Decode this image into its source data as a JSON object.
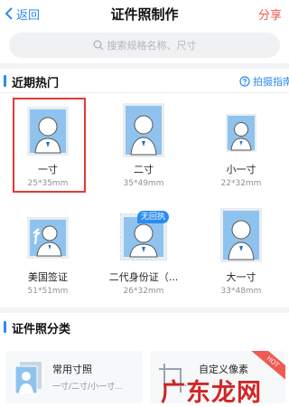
{
  "header": {
    "back_label": "返回",
    "title": "证件照制作",
    "share_label": "分享"
  },
  "search": {
    "placeholder": "搜索规格名称、尺寸"
  },
  "hot": {
    "title": "近期热门",
    "guide_label": "拍摄指南",
    "items": [
      {
        "name": "一寸",
        "size": "25*35mm",
        "selected": true
      },
      {
        "name": "二寸",
        "size": "35*49mm"
      },
      {
        "name": "小一寸",
        "size": "22*32mm"
      },
      {
        "name": "美国签证",
        "size": "51*51mm"
      },
      {
        "name": "二代身份证（...",
        "size": "26*32mm",
        "badge": "无回执"
      },
      {
        "name": "大一寸",
        "size": "33*48mm"
      }
    ]
  },
  "categories": {
    "title": "证件照分类",
    "cards": [
      {
        "title": "常用寸照",
        "subtitle": "一寸/二寸/小一寸..."
      },
      {
        "title": "自定义像素",
        "ribbon": "HOT"
      }
    ]
  },
  "watermark": "广东龙网",
  "colors": {
    "accent": "#2a8bf2",
    "share": "#ee5a52",
    "selection": "#e53935",
    "photo_bg": "#8fc3ee"
  }
}
